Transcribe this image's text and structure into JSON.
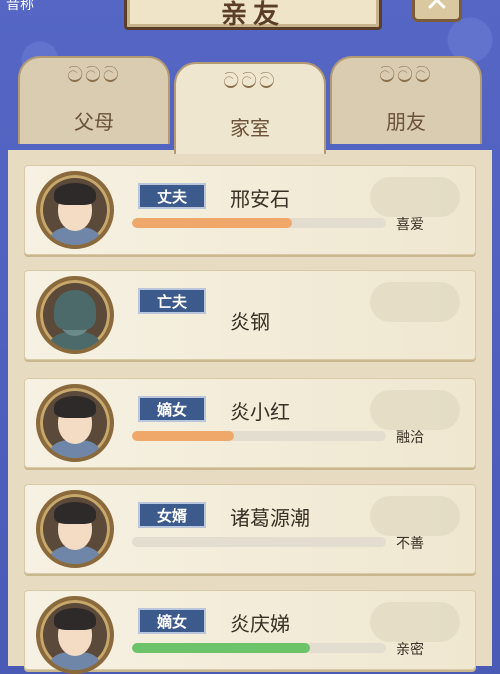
{
  "header": {
    "title": "亲友",
    "corner_text": "音称",
    "close_glyph": "✕"
  },
  "tabs": [
    {
      "label": "父母",
      "active": false
    },
    {
      "label": "家室",
      "active": true
    },
    {
      "label": "朋友",
      "active": false
    }
  ],
  "relatives": [
    {
      "relation": "丈夫",
      "name": "邢安石",
      "status": "喜爱",
      "affinity": 0.63,
      "bar_color": "#f0a86a",
      "show_bar": true
    },
    {
      "relation": "亡夫",
      "name": "炎钢",
      "status": "",
      "affinity": 0,
      "bar_color": "",
      "show_bar": false
    },
    {
      "relation": "嫡女",
      "name": "炎小红",
      "status": "融洽",
      "affinity": 0.4,
      "bar_color": "#f0a86a",
      "show_bar": true
    },
    {
      "relation": "女婿",
      "name": "诸葛源潮",
      "status": "不善",
      "affinity": 0.0,
      "bar_color": "#f0a86a",
      "show_bar": true
    },
    {
      "relation": "嫡女",
      "name": "炎庆娣",
      "status": "亲密",
      "affinity": 0.7,
      "bar_color": "#6cc36a",
      "show_bar": true
    }
  ]
}
